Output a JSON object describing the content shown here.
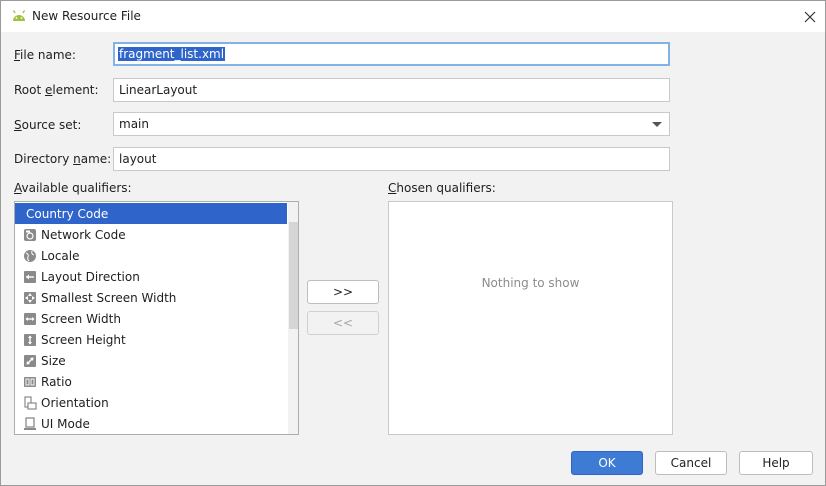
{
  "window": {
    "title": "New Resource File",
    "icon": "android-icon",
    "close_icon": "close-icon"
  },
  "form": {
    "file_name": {
      "label_key": "F",
      "label_rest": "ile name:",
      "value": "fragment_list.xml"
    },
    "root_element": {
      "label_pre": "Root ",
      "label_key": "e",
      "label_rest": "lement:",
      "value": "LinearLayout"
    },
    "source_set": {
      "label_key": "S",
      "label_rest": "ource set:",
      "value": "main"
    },
    "directory_name": {
      "label_pre": "Directory ",
      "label_key": "n",
      "label_rest": "ame:",
      "value": "layout"
    }
  },
  "available": {
    "label_pre": "",
    "label_key": "A",
    "label_rest": "vailable qualifiers:",
    "items": [
      {
        "label": "Country Code",
        "icon": "none",
        "selected": true
      },
      {
        "label": "Network Code",
        "icon": "network-code-icon",
        "selected": false
      },
      {
        "label": "Locale",
        "icon": "globe-icon",
        "selected": false
      },
      {
        "label": "Layout Direction",
        "icon": "layout-direction-icon",
        "selected": false
      },
      {
        "label": "Smallest Screen Width",
        "icon": "smallest-screen-width-icon",
        "selected": false
      },
      {
        "label": "Screen Width",
        "icon": "screen-width-icon",
        "selected": false
      },
      {
        "label": "Screen Height",
        "icon": "screen-height-icon",
        "selected": false
      },
      {
        "label": "Size",
        "icon": "size-icon",
        "selected": false
      },
      {
        "label": "Ratio",
        "icon": "ratio-icon",
        "selected": false
      },
      {
        "label": "Orientation",
        "icon": "orientation-icon",
        "selected": false
      },
      {
        "label": "UI Mode",
        "icon": "ui-mode-icon",
        "selected": false
      }
    ]
  },
  "chosen": {
    "label_key": "C",
    "label_rest": "hosen qualifiers:",
    "empty_text": "Nothing to show"
  },
  "transfer": {
    "add_label": ">>",
    "remove_label": "<<"
  },
  "buttons": {
    "ok": "OK",
    "cancel": "Cancel",
    "help": "Help"
  },
  "colors": {
    "selection": "#2f65ca",
    "primary_button": "#3d7bd4",
    "android_green": "#9fc13c"
  }
}
